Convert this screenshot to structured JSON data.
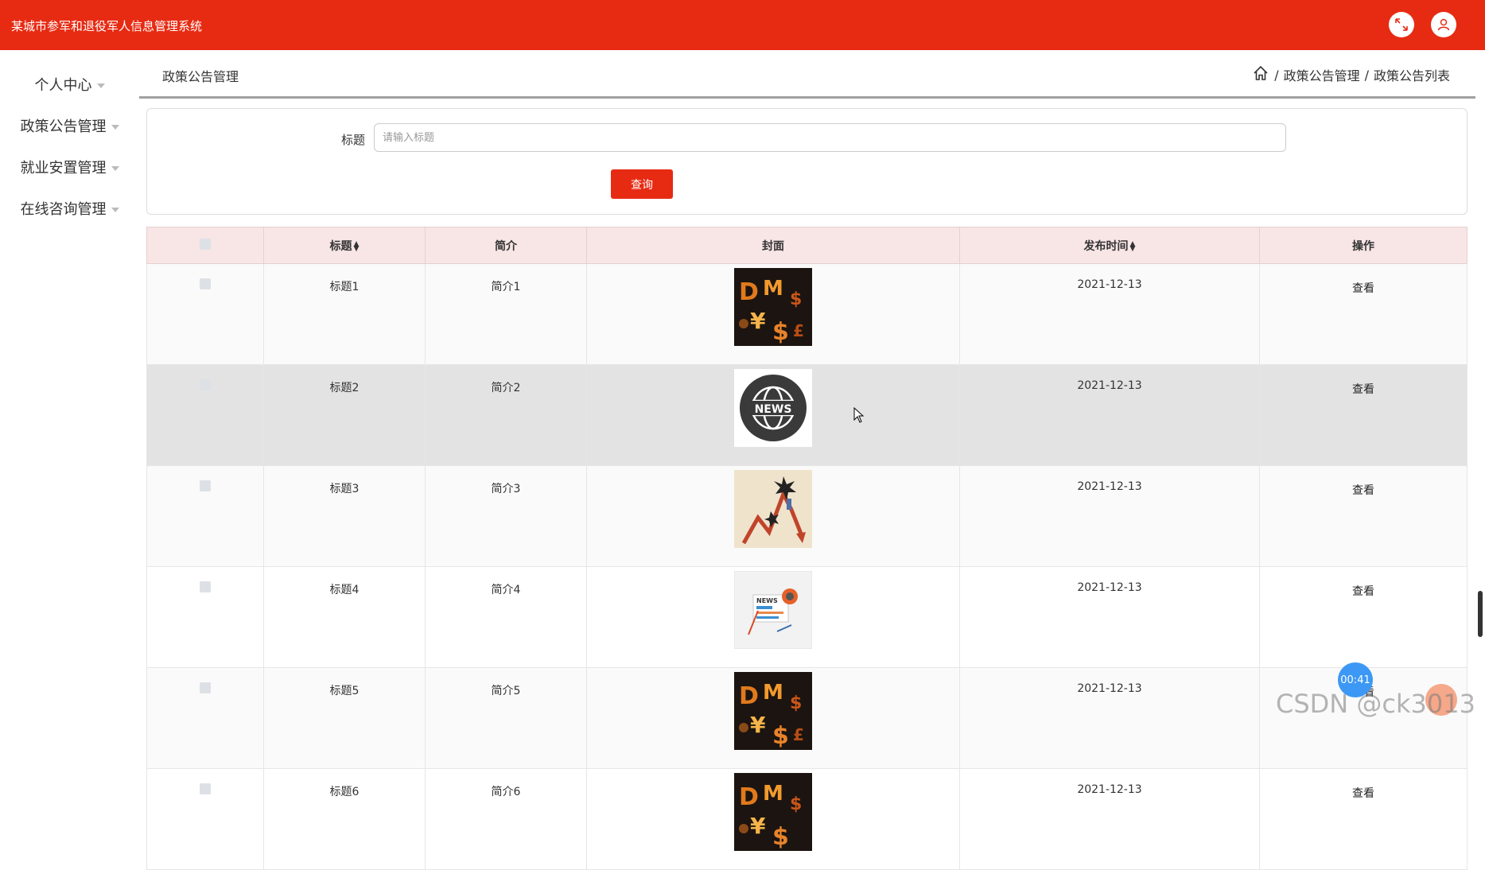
{
  "header": {
    "app_title": "某城市参军和退役军人信息管理系统",
    "icons": [
      "fullscreen-icon",
      "user-icon"
    ],
    "brand_color": "#e72b13"
  },
  "sidebar": {
    "items": [
      {
        "label": "个人中心"
      },
      {
        "label": "政策公告管理"
      },
      {
        "label": "就业安置管理"
      },
      {
        "label": "在线咨询管理"
      }
    ]
  },
  "page": {
    "title": "政策公告管理",
    "breadcrumb": [
      "政策公告管理",
      "政策公告列表"
    ]
  },
  "search": {
    "label": "标题",
    "placeholder": "请输入标题",
    "value": "",
    "button_label": "查询"
  },
  "table": {
    "columns": [
      "标题",
      "简介",
      "封面",
      "发布时间",
      "操作"
    ],
    "rows": [
      {
        "title": "标题1",
        "summary": "简介1",
        "cover": "money-symbols-image",
        "date": "2021-12-13",
        "action": "查看"
      },
      {
        "title": "标题2",
        "summary": "简介2",
        "cover": "news-globe-image",
        "date": "2021-12-13",
        "action": "查看"
      },
      {
        "title": "标题3",
        "summary": "简介3",
        "cover": "falling-chart-image",
        "date": "2021-12-13",
        "action": "查看"
      },
      {
        "title": "标题4",
        "summary": "简介4",
        "cover": "newspaper-image",
        "date": "2021-12-13",
        "action": "查看"
      },
      {
        "title": "标题5",
        "summary": "简介5",
        "cover": "money-symbols-image",
        "date": "2021-12-13",
        "action": "查看"
      },
      {
        "title": "标题6",
        "summary": "简介6",
        "cover": "money-symbols-image",
        "date": "2021-12-13",
        "action": "查看"
      }
    ]
  },
  "overlay": {
    "timer": "00:41",
    "watermark": "CSDN @ck3013"
  }
}
